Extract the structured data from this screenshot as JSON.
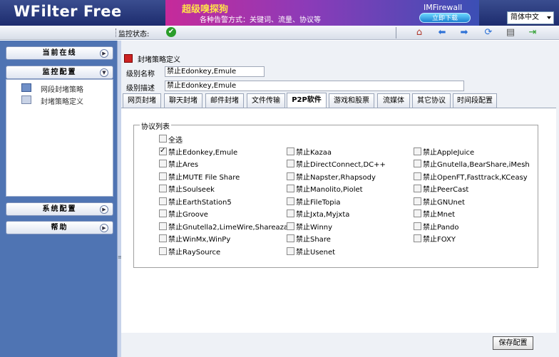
{
  "header": {
    "logo": "WFilter Free",
    "banner_title": "超级嗅探狗",
    "banner_sub": "各种告警方式：关键词、流量、协议等",
    "banner_brand": "IMFirewall",
    "banner_button": "立即下载",
    "language": "简体中文"
  },
  "toolbar": {
    "status_label": "监控状态:",
    "status_icon": "✔",
    "icons": [
      "home-icon",
      "back-icon",
      "forward-icon",
      "refresh-icon",
      "print-icon",
      "exit-icon"
    ]
  },
  "sidebar": {
    "online": "当前在线",
    "monitor_config": "监控配置",
    "links": [
      "网段封堵策略",
      "封堵策略定义"
    ],
    "system_config": "系统配置",
    "help": "帮助"
  },
  "main": {
    "title": "封堵策略定义",
    "level_name_label": "级别名称",
    "level_name_value": "禁止Edonkey,Emule",
    "level_desc_label": "级别描述",
    "level_desc_value": "禁止Edonkey,Emule",
    "tabs": [
      "网页封堵",
      "聊天封堵",
      "邮件封堵",
      "文件传输",
      "P2P软件",
      "游戏和股票",
      "流媒体",
      "其它协议",
      "时间段配置"
    ],
    "active_tab": "P2P软件",
    "list_legend": "协议列表",
    "select_all": "全选",
    "protocols": {
      "col1": [
        "禁止Edonkey,Emule",
        "禁止Ares",
        "禁止MUTE File Share",
        "禁止Soulseek",
        "禁止EarthStation5",
        "禁止Groove",
        "禁止Gnutella2,LimeWire,Shareaza",
        "禁止WinMx,WinPy",
        "禁止RaySource"
      ],
      "col2": [
        "禁止Kazaa",
        "禁止DirectConnect,DC++",
        "禁止Napster,Rhapsody",
        "禁止Manolito,Piolet",
        "禁止FileTopia",
        "禁止Jxta,Myjxta",
        "禁止Winny",
        "禁止Share",
        "禁止Usenet"
      ],
      "col3": [
        "禁止AppleJuice",
        "禁止Gnutella,BearShare,iMesh",
        "禁止OpenFT,Fasttrack,KCeasy",
        "禁止PeerCast",
        "禁止GNUnet",
        "禁止Mnet",
        "禁止Pando",
        "禁止FOXY"
      ]
    },
    "checked": [
      "禁止Edonkey,Emule"
    ],
    "save_button": "保存配置"
  }
}
